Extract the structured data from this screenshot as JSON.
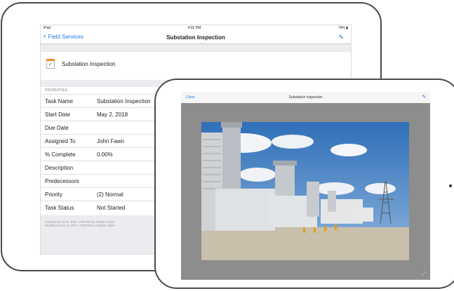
{
  "ios_status": {
    "device": "iPad",
    "time": "4:02 PM",
    "battery": "74%"
  },
  "navbar": {
    "back_label": "Field Services",
    "title": "Substation Inspection"
  },
  "item": {
    "title": "Substation Inspection"
  },
  "properties": {
    "header": "PROPERTIES",
    "rows": [
      {
        "key": "Task Name",
        "value": "Substation Inspection"
      },
      {
        "key": "Start Date",
        "value": "May 2, 2018"
      },
      {
        "key": "Due Date",
        "value": ""
      },
      {
        "key": "Assigned To",
        "value": "John Fawn"
      },
      {
        "key": "% Complete",
        "value": "0.00%"
      },
      {
        "key": "Description",
        "value": ""
      },
      {
        "key": "Predecessors",
        "value": ""
      },
      {
        "key": "Priority",
        "value": "(2) Normal"
      },
      {
        "key": "Task Status",
        "value": "Not Started"
      }
    ]
  },
  "footer": {
    "created": "Created at Jun 8, 2017, 2:05 PM by Global Admin",
    "modified": "Modified at Jun 8, 2017, 2:05 PM by Global Admin"
  },
  "viewer": {
    "close_label": "Close",
    "title": "Substation Inspection"
  },
  "colors": {
    "accent": "#1a7be0",
    "doc_icon": "#f28c28",
    "viewer_bg": "#8d8d8d"
  },
  "icons": [
    "wifi-icon",
    "battery-icon",
    "chevron-left-icon",
    "edit-icon",
    "checklist-doc-icon",
    "expand-icon"
  ]
}
